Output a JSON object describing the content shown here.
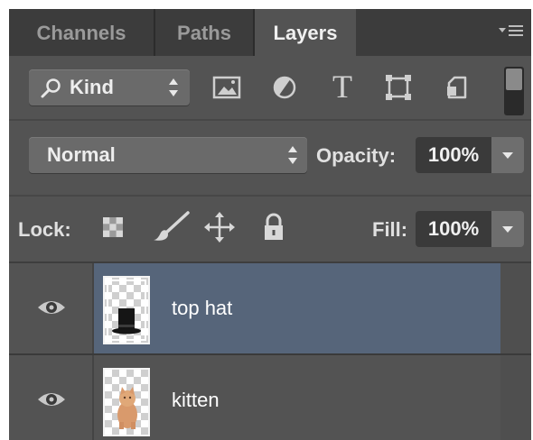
{
  "tabs": [
    {
      "label": "Channels",
      "active": false
    },
    {
      "label": "Paths",
      "active": false
    },
    {
      "label": "Layers",
      "active": true
    }
  ],
  "filter": {
    "kind_label": "Kind",
    "icons": [
      "pixel-layer-filter-icon",
      "adjustment-layer-filter-icon",
      "type-layer-filter-icon",
      "shape-layer-filter-icon",
      "smart-object-filter-icon"
    ],
    "type_icon_glyph": "T"
  },
  "blend": {
    "mode": "Normal",
    "opacity_label": "Opacity:",
    "opacity_value": "100%"
  },
  "lock": {
    "label": "Lock:",
    "icons": [
      "lock-transparent-pixels-icon",
      "lock-image-pixels-icon",
      "lock-position-icon",
      "lock-all-icon"
    ],
    "fill_label": "Fill:",
    "fill_value": "100%"
  },
  "layers": [
    {
      "name": "top hat",
      "selected": true,
      "visible": true
    },
    {
      "name": "kitten",
      "selected": false,
      "visible": true
    }
  ],
  "colors": {
    "panel_bg": "#535353",
    "tabbar_bg": "#3c3c3c",
    "selected_layer": "#56657a"
  }
}
